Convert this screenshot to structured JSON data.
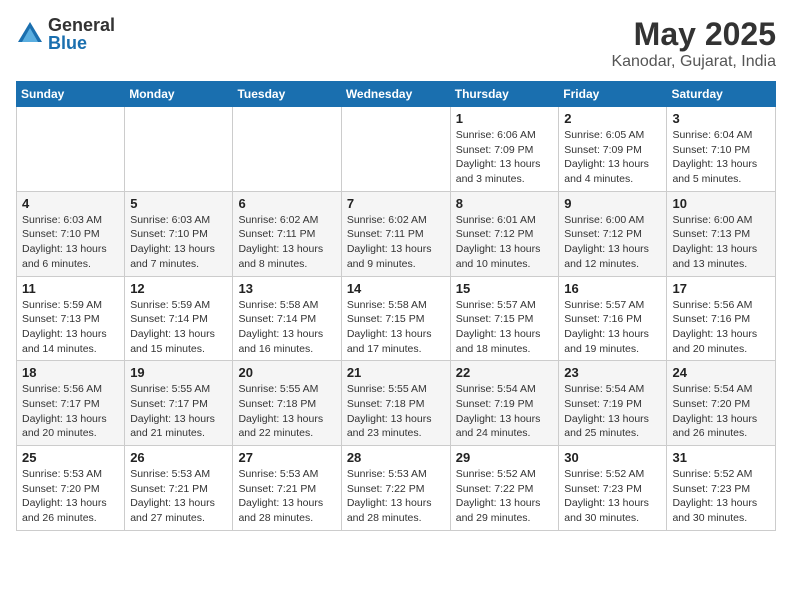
{
  "header": {
    "logo_general": "General",
    "logo_blue": "Blue",
    "month_title": "May 2025",
    "location": "Kanodar, Gujarat, India"
  },
  "weekdays": [
    "Sunday",
    "Monday",
    "Tuesday",
    "Wednesday",
    "Thursday",
    "Friday",
    "Saturday"
  ],
  "weeks": [
    [
      {
        "day": "",
        "info": ""
      },
      {
        "day": "",
        "info": ""
      },
      {
        "day": "",
        "info": ""
      },
      {
        "day": "",
        "info": ""
      },
      {
        "day": "1",
        "info": "Sunrise: 6:06 AM\nSunset: 7:09 PM\nDaylight: 13 hours\nand 3 minutes."
      },
      {
        "day": "2",
        "info": "Sunrise: 6:05 AM\nSunset: 7:09 PM\nDaylight: 13 hours\nand 4 minutes."
      },
      {
        "day": "3",
        "info": "Sunrise: 6:04 AM\nSunset: 7:10 PM\nDaylight: 13 hours\nand 5 minutes."
      }
    ],
    [
      {
        "day": "4",
        "info": "Sunrise: 6:03 AM\nSunset: 7:10 PM\nDaylight: 13 hours\nand 6 minutes."
      },
      {
        "day": "5",
        "info": "Sunrise: 6:03 AM\nSunset: 7:10 PM\nDaylight: 13 hours\nand 7 minutes."
      },
      {
        "day": "6",
        "info": "Sunrise: 6:02 AM\nSunset: 7:11 PM\nDaylight: 13 hours\nand 8 minutes."
      },
      {
        "day": "7",
        "info": "Sunrise: 6:02 AM\nSunset: 7:11 PM\nDaylight: 13 hours\nand 9 minutes."
      },
      {
        "day": "8",
        "info": "Sunrise: 6:01 AM\nSunset: 7:12 PM\nDaylight: 13 hours\nand 10 minutes."
      },
      {
        "day": "9",
        "info": "Sunrise: 6:00 AM\nSunset: 7:12 PM\nDaylight: 13 hours\nand 12 minutes."
      },
      {
        "day": "10",
        "info": "Sunrise: 6:00 AM\nSunset: 7:13 PM\nDaylight: 13 hours\nand 13 minutes."
      }
    ],
    [
      {
        "day": "11",
        "info": "Sunrise: 5:59 AM\nSunset: 7:13 PM\nDaylight: 13 hours\nand 14 minutes."
      },
      {
        "day": "12",
        "info": "Sunrise: 5:59 AM\nSunset: 7:14 PM\nDaylight: 13 hours\nand 15 minutes."
      },
      {
        "day": "13",
        "info": "Sunrise: 5:58 AM\nSunset: 7:14 PM\nDaylight: 13 hours\nand 16 minutes."
      },
      {
        "day": "14",
        "info": "Sunrise: 5:58 AM\nSunset: 7:15 PM\nDaylight: 13 hours\nand 17 minutes."
      },
      {
        "day": "15",
        "info": "Sunrise: 5:57 AM\nSunset: 7:15 PM\nDaylight: 13 hours\nand 18 minutes."
      },
      {
        "day": "16",
        "info": "Sunrise: 5:57 AM\nSunset: 7:16 PM\nDaylight: 13 hours\nand 19 minutes."
      },
      {
        "day": "17",
        "info": "Sunrise: 5:56 AM\nSunset: 7:16 PM\nDaylight: 13 hours\nand 20 minutes."
      }
    ],
    [
      {
        "day": "18",
        "info": "Sunrise: 5:56 AM\nSunset: 7:17 PM\nDaylight: 13 hours\nand 20 minutes."
      },
      {
        "day": "19",
        "info": "Sunrise: 5:55 AM\nSunset: 7:17 PM\nDaylight: 13 hours\nand 21 minutes."
      },
      {
        "day": "20",
        "info": "Sunrise: 5:55 AM\nSunset: 7:18 PM\nDaylight: 13 hours\nand 22 minutes."
      },
      {
        "day": "21",
        "info": "Sunrise: 5:55 AM\nSunset: 7:18 PM\nDaylight: 13 hours\nand 23 minutes."
      },
      {
        "day": "22",
        "info": "Sunrise: 5:54 AM\nSunset: 7:19 PM\nDaylight: 13 hours\nand 24 minutes."
      },
      {
        "day": "23",
        "info": "Sunrise: 5:54 AM\nSunset: 7:19 PM\nDaylight: 13 hours\nand 25 minutes."
      },
      {
        "day": "24",
        "info": "Sunrise: 5:54 AM\nSunset: 7:20 PM\nDaylight: 13 hours\nand 26 minutes."
      }
    ],
    [
      {
        "day": "25",
        "info": "Sunrise: 5:53 AM\nSunset: 7:20 PM\nDaylight: 13 hours\nand 26 minutes."
      },
      {
        "day": "26",
        "info": "Sunrise: 5:53 AM\nSunset: 7:21 PM\nDaylight: 13 hours\nand 27 minutes."
      },
      {
        "day": "27",
        "info": "Sunrise: 5:53 AM\nSunset: 7:21 PM\nDaylight: 13 hours\nand 28 minutes."
      },
      {
        "day": "28",
        "info": "Sunrise: 5:53 AM\nSunset: 7:22 PM\nDaylight: 13 hours\nand 28 minutes."
      },
      {
        "day": "29",
        "info": "Sunrise: 5:52 AM\nSunset: 7:22 PM\nDaylight: 13 hours\nand 29 minutes."
      },
      {
        "day": "30",
        "info": "Sunrise: 5:52 AM\nSunset: 7:23 PM\nDaylight: 13 hours\nand 30 minutes."
      },
      {
        "day": "31",
        "info": "Sunrise: 5:52 AM\nSunset: 7:23 PM\nDaylight: 13 hours\nand 30 minutes."
      }
    ]
  ]
}
